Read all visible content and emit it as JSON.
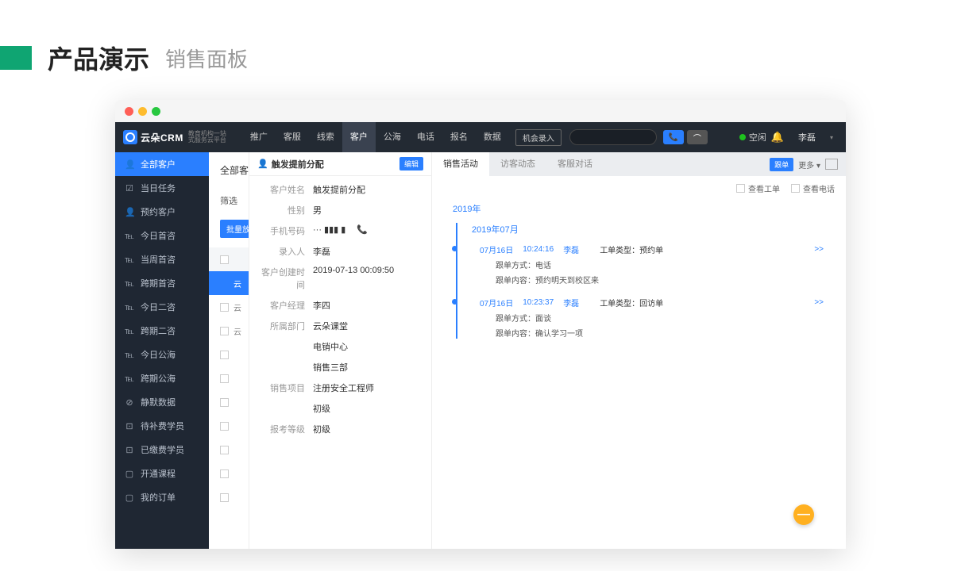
{
  "pageHeader": {
    "title": "产品演示",
    "subtitle": "销售面板"
  },
  "logo": {
    "text": "云朵CRM",
    "sub1": "教育机构一站",
    "sub2": "式服务云平台"
  },
  "topnav": [
    "推广",
    "客服",
    "线索",
    "客户",
    "公海",
    "电话",
    "报名",
    "数据"
  ],
  "topnav_active_index": 3,
  "opportunity": "机会录入",
  "status": "空闲",
  "user": "李磊",
  "sidebar": [
    {
      "icon": "👤",
      "label": "全部客户",
      "active": true
    },
    {
      "icon": "☑",
      "label": "当日任务"
    },
    {
      "icon": "👤",
      "label": "预约客户"
    },
    {
      "icon": "℡",
      "label": "今日首咨"
    },
    {
      "icon": "℡",
      "label": "当周首咨"
    },
    {
      "icon": "℡",
      "label": "跨期首咨"
    },
    {
      "icon": "℡",
      "label": "今日二咨"
    },
    {
      "icon": "℡",
      "label": "跨期二咨"
    },
    {
      "icon": "℡",
      "label": "今日公海"
    },
    {
      "icon": "℡",
      "label": "跨期公海"
    },
    {
      "icon": "⊘",
      "label": "静默数据"
    },
    {
      "icon": "⊡",
      "label": "待补费学员"
    },
    {
      "icon": "⊡",
      "label": "已缴费学员"
    },
    {
      "icon": "▢",
      "label": "开通课程"
    },
    {
      "icon": "▢",
      "label": "我的订单"
    }
  ],
  "content": {
    "heading": "全部客户",
    "filter": "筛选",
    "batch": "批量放",
    "list_label": "云"
  },
  "detail": {
    "title": "触发提前分配",
    "edit": "编辑",
    "rows": [
      {
        "label": "客户姓名",
        "val": "触发提前分配"
      },
      {
        "label": "性别",
        "val": "男"
      },
      {
        "label": "手机号码",
        "val": "··· ▮▮▮ ▮",
        "phone": true
      },
      {
        "label": "录入人",
        "val": "李磊"
      },
      {
        "label": "客户创建时间",
        "val": "2019-07-13 00:09:50"
      },
      {
        "label": "客户经理",
        "val": "李四"
      },
      {
        "label": "所属部门",
        "val": "云朵课堂"
      },
      {
        "label": "",
        "val": "电销中心"
      },
      {
        "label": "",
        "val": "销售三部"
      },
      {
        "label": "销售项目",
        "val": "注册安全工程师"
      },
      {
        "label": "",
        "val": "初级"
      },
      {
        "label": "报考等级",
        "val": "初级"
      }
    ]
  },
  "activity": {
    "tabs": [
      "销售活动",
      "访客动态",
      "客服对话"
    ],
    "active_tab": 0,
    "follow_btn": "跟单",
    "more_btn": "更多 ▾",
    "checks": [
      "查看工单",
      "查看电话"
    ],
    "year": "2019年",
    "month": "2019年07月",
    "items": [
      {
        "date": "07月16日",
        "time": "10:24:16",
        "user": "李磊",
        "type": "工单类型：预约单",
        "method": "跟单方式：电话",
        "content": "跟单内容：预约明天到校区来"
      },
      {
        "date": "07月16日",
        "time": "10:23:37",
        "user": "李磊",
        "type": "工单类型：回访单",
        "method": "跟单方式：面谈",
        "content": "跟单内容：确认学习一项"
      }
    ],
    "arrow": ">>"
  }
}
